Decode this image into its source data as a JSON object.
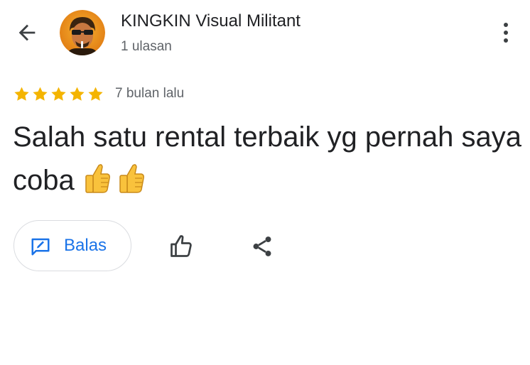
{
  "header": {
    "back_icon": "arrow-left-icon",
    "reviewer_name": "KINGKIN Visual Militant",
    "reviewer_reviews": "1 ulasan",
    "more_icon": "more-vertical-icon"
  },
  "review": {
    "rating": 5,
    "rating_max": 5,
    "time_ago": "7 bulan lalu",
    "text": "Salah satu rental terbaik yg pernah saya coba",
    "emoji": [
      "thumbs-up-emoji",
      "thumbs-up-emoji"
    ]
  },
  "actions": {
    "reply_label": "Balas",
    "reply_icon": "reply-icon",
    "like_icon": "thumbs-up-outline-icon",
    "share_icon": "share-icon"
  },
  "colors": {
    "star": "#f4b400",
    "accent": "#1a73e8",
    "text_primary": "#202124",
    "text_secondary": "#5f6368",
    "border": "#dadce0"
  }
}
